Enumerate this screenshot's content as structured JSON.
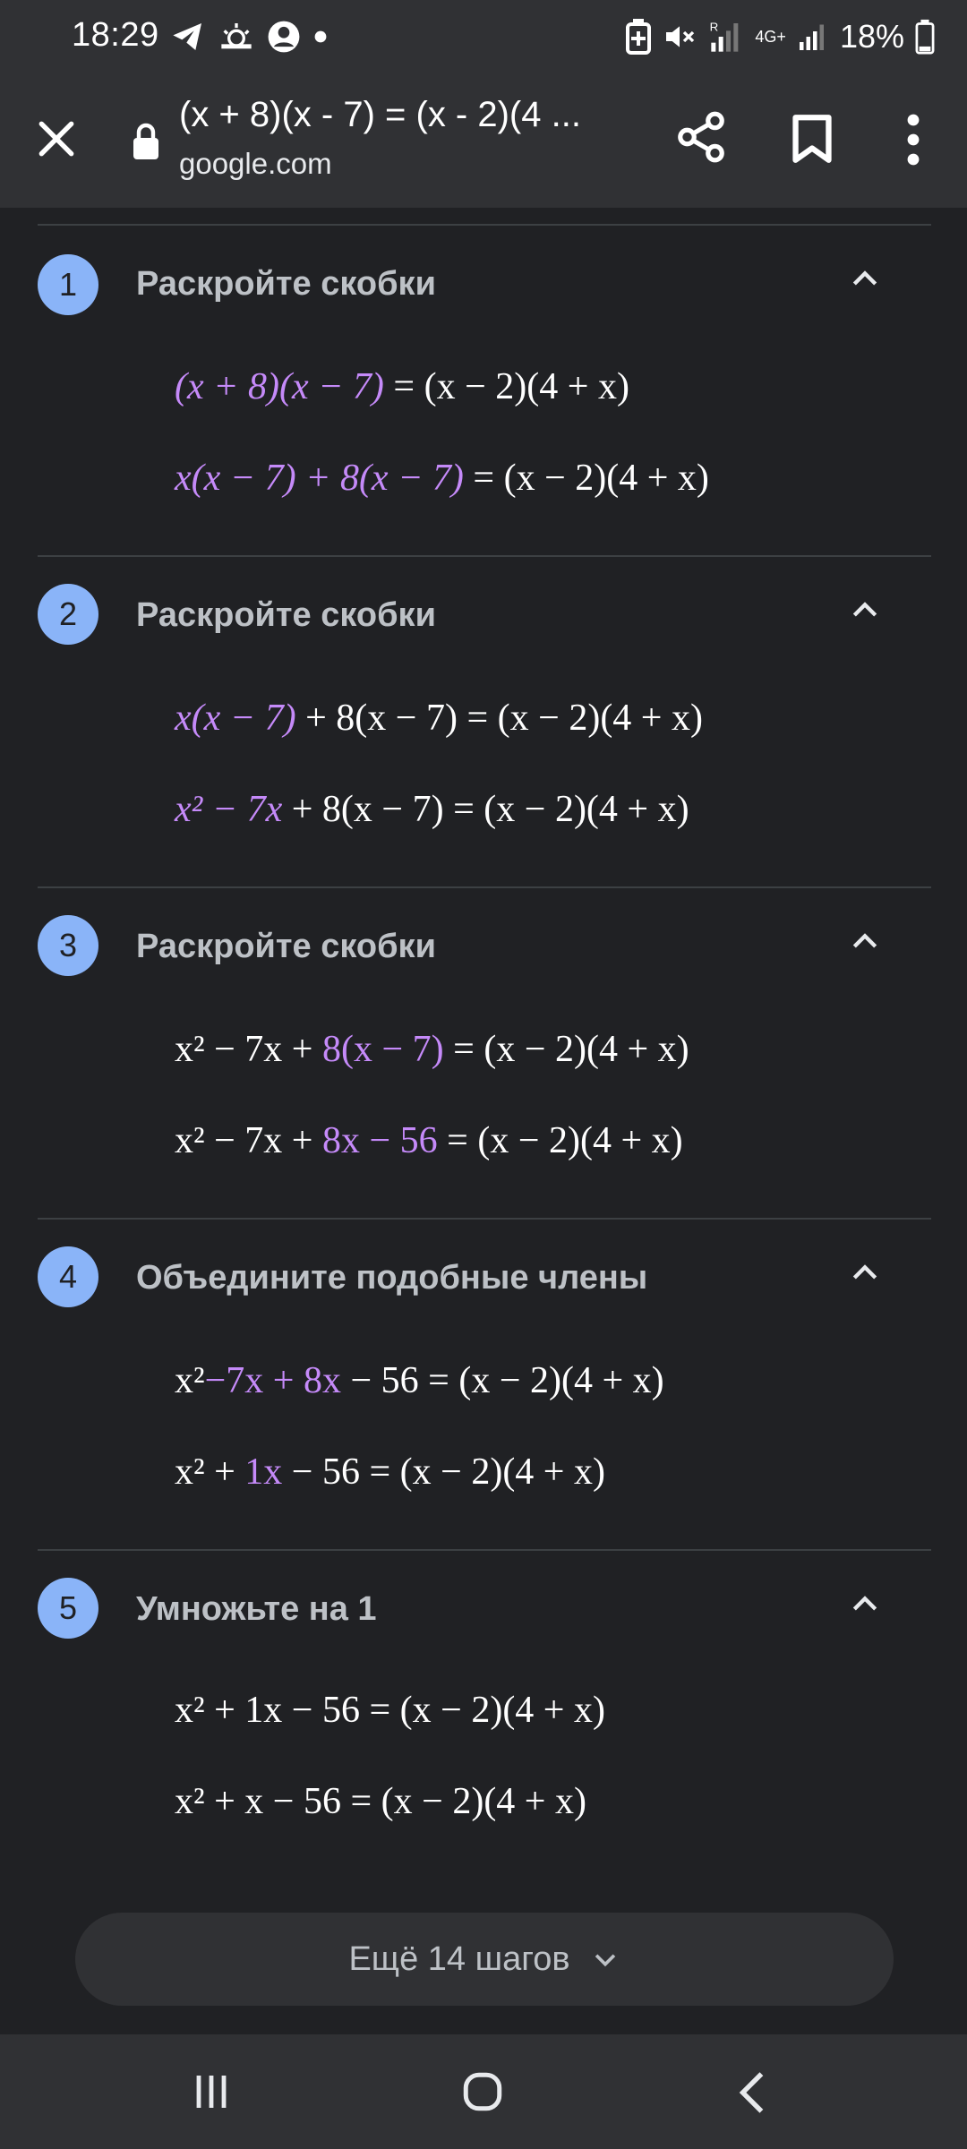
{
  "status_bar": {
    "time": "18:29",
    "battery": "18%",
    "network": "4G+"
  },
  "toolbar": {
    "title": "(x + 8)(x - 7) = (x - 2)(4 ...",
    "url": "google.com"
  },
  "steps": [
    {
      "number": "1",
      "title": "Раскройте скобки"
    },
    {
      "number": "2",
      "title": "Раскройте скобки"
    },
    {
      "number": "3",
      "title": "Раскройте скобки"
    },
    {
      "number": "4",
      "title": "Объедините подобные члены"
    },
    {
      "number": "5",
      "title": "Умножьте на 1"
    }
  ],
  "equations": {
    "rhs": "= (x − 2)(4 + x)",
    "s1a": "(x + 8)(x − 7)",
    "s1b": "x(x − 7) + 8(x − 7)",
    "s2a_hl": "x(x − 7)",
    "s2a_rest": "+ 8(x − 7)",
    "s2b_hl": "x² − 7x",
    "s2b_rest": "+ 8(x − 7)",
    "s3a_pre": "x² − 7x +",
    "s3a_hl": "8(x − 7)",
    "s3b_pre": "x² − 7x +",
    "s3b_hl": "8x − 56",
    "s4a_pre": "x²",
    "s4a_hl": "−7x + 8x",
    "s4a_post": "− 56",
    "s4b_pre": "x² +",
    "s4b_hl": "1x",
    "s4b_post": "− 56",
    "s5a": "x² + 1x − 56",
    "s5b": "x² + x − 56"
  },
  "more_button": {
    "label": "Ещё 14 шагов"
  },
  "colors": {
    "background": "#202124",
    "badge": "#8ab4f8",
    "highlight": "#c58af9"
  },
  "icons": [
    "telegram-icon",
    "weather-icon",
    "account-icon",
    "battery-saver-icon",
    "mute-icon",
    "signal-icon",
    "battery-icon",
    "close-icon",
    "lock-icon",
    "share-icon",
    "bookmark-icon",
    "more-vert-icon",
    "chevron-up-icon",
    "chevron-down-icon",
    "recents-icon",
    "home-icon",
    "back-icon"
  ]
}
